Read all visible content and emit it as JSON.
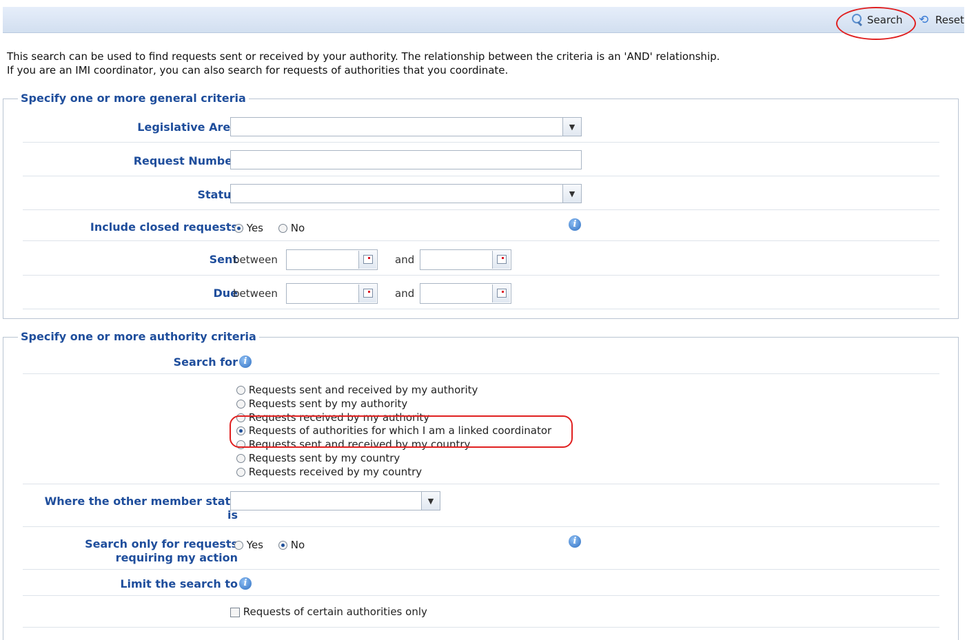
{
  "toolbar": {
    "search_label": "Search",
    "reset_label": "Reset"
  },
  "intro": {
    "line1": "This search can be used to find requests sent or received by your authority. The relationship between the criteria is an 'AND' relationship.",
    "line2": "If you are an IMI coordinator, you can also search for requests of authorities that you coordinate."
  },
  "general": {
    "legend": "Specify one or more general criteria",
    "legislative_area_label": "Legislative Area",
    "legislative_area_value": "",
    "request_number_label": "Request Number",
    "request_number_value": "",
    "status_label": "Status",
    "status_value": "",
    "include_closed_label": "Include closed requests",
    "include_closed_yes": "Yes",
    "include_closed_no": "No",
    "include_closed_selected": "Yes",
    "sent_label": "Sent",
    "due_label": "Due",
    "between_text": "between",
    "and_text": "and"
  },
  "authority": {
    "legend": "Specify one or more authority criteria",
    "search_for_label": "Search for",
    "options": [
      "Requests sent and received by my authority",
      "Requests sent by my authority",
      "Requests received by my authority",
      "Requests of authorities for which I am a linked coordinator",
      "Requests sent and received by my country",
      "Requests sent by my country",
      "Requests received by my country"
    ],
    "selected_option_index": 3,
    "other_member_state_label_1": "Where the other member state",
    "other_member_state_label_2": "is",
    "other_member_state_value": "",
    "my_action_label_1": "Search only for requests",
    "my_action_label_2": "requiring my action",
    "my_action_yes": "Yes",
    "my_action_no": "No",
    "my_action_selected": "No",
    "limit_label": "Limit the search to",
    "certain_authorities_label": "Requests of certain authorities only",
    "certain_authorities_checked": false
  },
  "colors": {
    "label_blue": "#1f4e9c",
    "annotation_red": "#e02020",
    "toolbar_bg": "#dbe5f3"
  }
}
